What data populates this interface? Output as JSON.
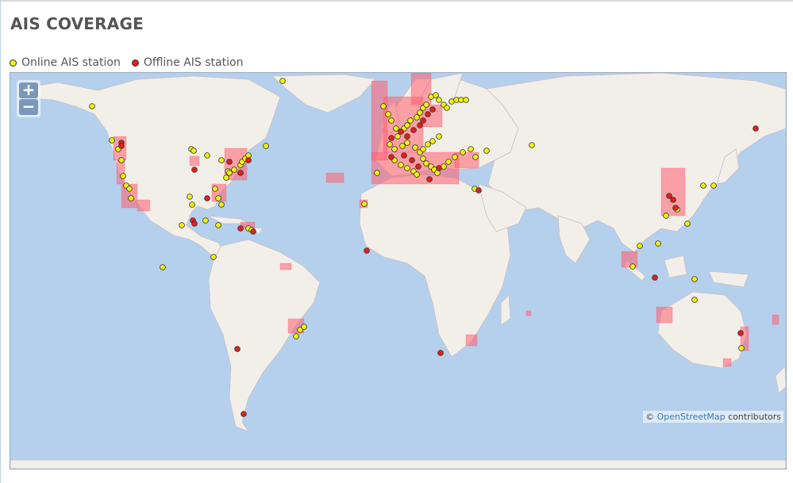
{
  "page": {
    "title": "AIS COVERAGE"
  },
  "legend": {
    "online_label": "Online AIS station",
    "offline_label": "Offline AIS station",
    "online_color": "#f2f20a",
    "offline_color": "#e0201c"
  },
  "map": {
    "zoom_in_label": "+",
    "zoom_out_label": "−",
    "attribution_prefix": "©",
    "attribution_link": "OpenStreetMap",
    "attribution_suffix": " contributors",
    "coverage_color": "#ff5c6e",
    "ocean_color": "#b5d0ec",
    "land_color": "#f2efe9"
  }
}
